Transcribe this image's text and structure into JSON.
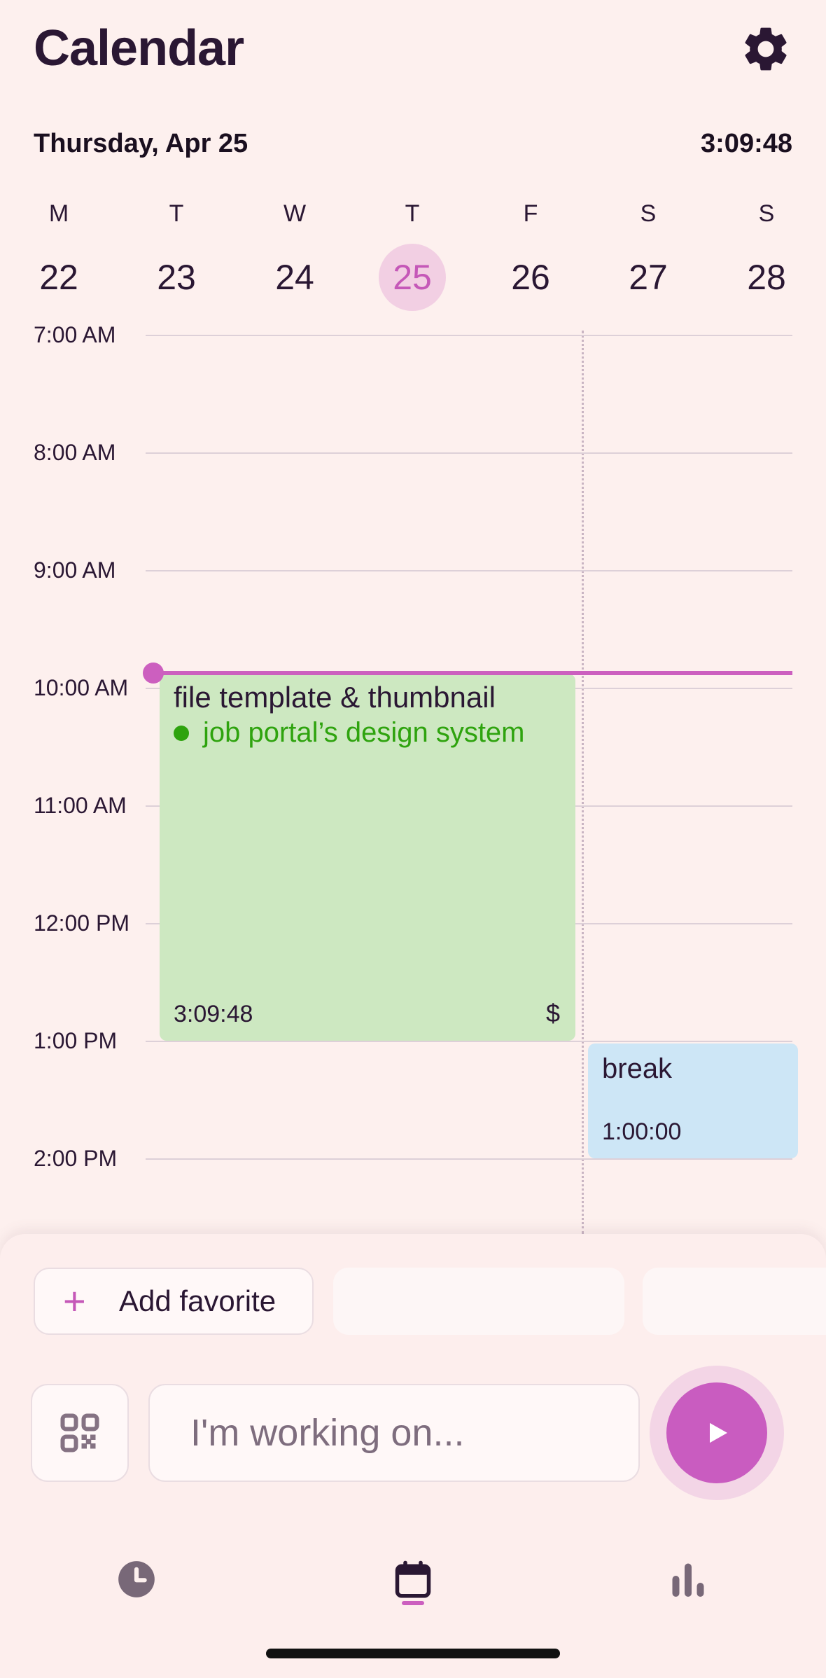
{
  "header": {
    "title": "Calendar",
    "settings_icon": "gear-icon",
    "date": "Thursday, Apr 25",
    "clock": "3:09:48"
  },
  "week": {
    "days": [
      {
        "letter": "M",
        "num": "22",
        "today": false
      },
      {
        "letter": "T",
        "num": "23",
        "today": false
      },
      {
        "letter": "W",
        "num": "24",
        "today": false
      },
      {
        "letter": "T",
        "num": "25",
        "today": true
      },
      {
        "letter": "F",
        "num": "26",
        "today": false
      },
      {
        "letter": "S",
        "num": "27",
        "today": false
      },
      {
        "letter": "S",
        "num": "28",
        "today": false
      }
    ]
  },
  "timeline": {
    "hours": [
      "7:00 AM",
      "8:00 AM",
      "9:00 AM",
      "10:00 AM",
      "11:00 AM",
      "12:00 PM",
      "1:00 PM",
      "2:00 PM"
    ]
  },
  "events": {
    "work": {
      "title": "file template & thumbnail",
      "project": "job portal’s design system",
      "duration": "3:09:48",
      "billable_symbol": "$",
      "color": "#cde8c1",
      "project_color": "#2ea30e"
    },
    "break": {
      "title": "break",
      "duration": "1:00:00",
      "color": "#cde6f6"
    }
  },
  "favorites": {
    "add_label": "Add favorite"
  },
  "tracker": {
    "placeholder": "I'm working on...",
    "qr_icon": "qr-code-icon",
    "play_icon": "play-icon"
  },
  "nav": {
    "items": [
      "clock-icon",
      "calendar-icon",
      "bar-chart-icon"
    ],
    "active": "calendar-icon"
  },
  "colors": {
    "accent": "#cc5fbf",
    "background": "#fdf0ee",
    "text": "#2a1733"
  }
}
